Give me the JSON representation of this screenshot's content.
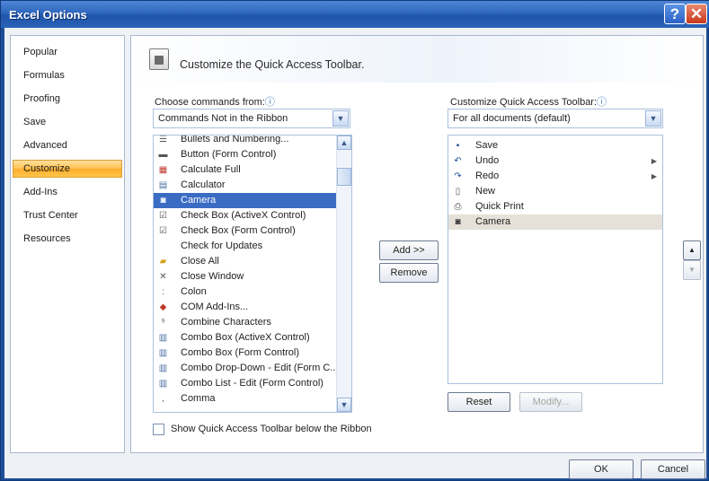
{
  "window": {
    "title": "Excel Options",
    "help_glyph": "?",
    "close_glyph": "✕"
  },
  "sidebar": {
    "items": [
      "Popular",
      "Formulas",
      "Proofing",
      "Save",
      "Advanced",
      "Customize",
      "Add-Ins",
      "Trust Center",
      "Resources"
    ],
    "selected": "Customize"
  },
  "header": {
    "text": "Customize the Quick Access Toolbar.",
    "icon": "quick-access-toolbar-icon"
  },
  "left": {
    "label": "Choose commands from:",
    "combo_value": "Commands Not in the Ribbon",
    "commands": [
      {
        "label": "Bullets and Numbering...",
        "icon": "bullets-icon"
      },
      {
        "label": "Button (Form Control)",
        "icon": "button-icon"
      },
      {
        "label": "Calculate Full",
        "icon": "calculate-icon"
      },
      {
        "label": "Calculator",
        "icon": "calculator-icon"
      },
      {
        "label": "Camera",
        "icon": "camera-icon",
        "selected": true
      },
      {
        "label": "Check Box (ActiveX Control)",
        "icon": "checkbox-icon"
      },
      {
        "label": "Check Box (Form Control)",
        "icon": "checkbox-icon"
      },
      {
        "label": "Check for Updates",
        "icon": ""
      },
      {
        "label": "Close All",
        "icon": "folder-icon"
      },
      {
        "label": "Close Window",
        "icon": "close-icon"
      },
      {
        "label": "Colon",
        "icon": "colon-icon"
      },
      {
        "label": "COM Add-Ins...",
        "icon": "addin-icon"
      },
      {
        "label": "Combine Characters",
        "icon": "combine-icon"
      },
      {
        "label": "Combo Box (ActiveX Control)",
        "icon": "combo-icon"
      },
      {
        "label": "Combo Box (Form Control)",
        "icon": "combo-icon"
      },
      {
        "label": "Combo Drop-Down - Edit (Form C...",
        "icon": "combo-icon"
      },
      {
        "label": "Combo List - Edit (Form Control)",
        "icon": "combo-icon"
      },
      {
        "label": "Comma",
        "icon": "comma-icon"
      }
    ]
  },
  "right": {
    "label": "Customize Quick Access Toolbar:",
    "combo_value": "For all documents (default)",
    "items": [
      {
        "label": "Save",
        "icon": "save-icon",
        "submenu": false
      },
      {
        "label": "Undo",
        "icon": "undo-icon",
        "submenu": true
      },
      {
        "label": "Redo",
        "icon": "redo-icon",
        "submenu": true
      },
      {
        "label": "New",
        "icon": "new-icon",
        "submenu": false
      },
      {
        "label": "Quick Print",
        "icon": "print-icon",
        "submenu": false
      },
      {
        "label": "Camera",
        "icon": "camera-icon",
        "submenu": false,
        "selected": true
      }
    ]
  },
  "buttons": {
    "add": "Add >>",
    "remove": "Remove",
    "reset": "Reset",
    "modify": "Modify...",
    "ok": "OK",
    "cancel": "Cancel",
    "move_up": "▲",
    "move_down": "▼"
  },
  "checkbox": {
    "label": "Show Quick Access Toolbar below the Ribbon",
    "checked": false
  },
  "glyphs": {
    "dropdown": "▼",
    "scroll_up": "▲",
    "scroll_down": "▼",
    "submenu": "▶",
    "info": "ⓘ"
  }
}
